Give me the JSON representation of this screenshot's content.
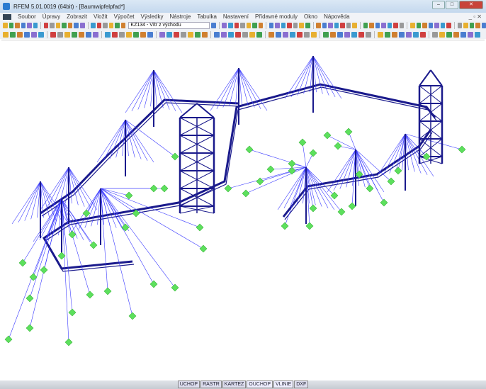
{
  "window": {
    "title": "RFEM 5.01.0019 (64bit) - [Baumwipfelpfad*]",
    "minimize": "–",
    "maximize": "□",
    "close": "✕"
  },
  "menu": [
    "Soubor",
    "Úpravy",
    "Zobrazit",
    "Vložit",
    "Výpočet",
    "Výsledky",
    "Nástroje",
    "Tabulka",
    "Nastavení",
    "Přídavné moduly",
    "Okno",
    "Nápověda"
  ],
  "mdi_controls": "_ ▫ ✕",
  "toolbar": {
    "loadcase": "KZ134 - Vítr z východu"
  },
  "status_bar": [
    "UCHOP",
    "RASTR",
    "KARTEZ",
    "OUCHOP",
    "VLINIE",
    "DXF"
  ],
  "colors": {
    "structure": "#1a1a8c",
    "cables": "#3a3aff",
    "supports": "#5de05d",
    "background": "#ffffff"
  }
}
